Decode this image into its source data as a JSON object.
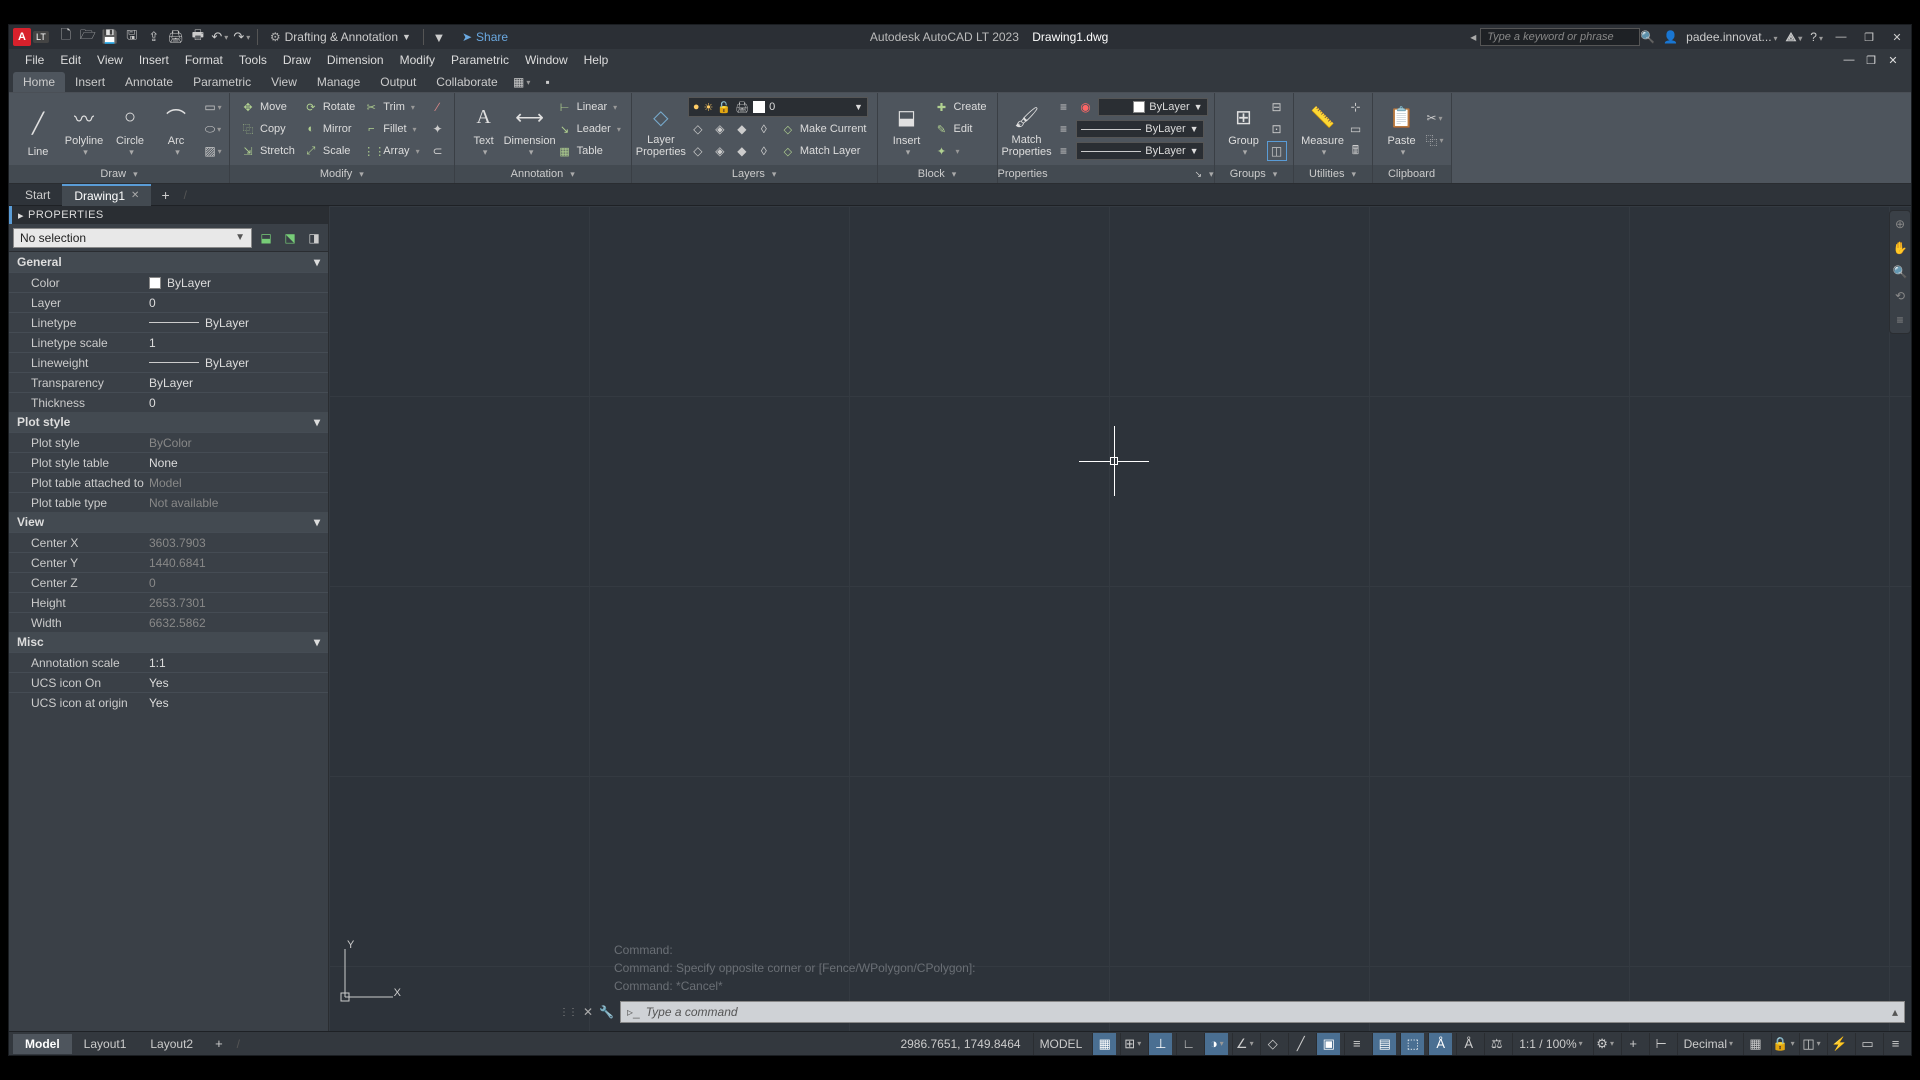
{
  "title": {
    "app": "Autodesk AutoCAD LT 2023",
    "doc": "Drawing1.dwg"
  },
  "qat_workspace": "Drafting & Annotation",
  "share": "Share",
  "search_placeholder": "Type a keyword or phrase",
  "user": "padee.innovat...",
  "menus": [
    "File",
    "Edit",
    "View",
    "Insert",
    "Format",
    "Tools",
    "Draw",
    "Dimension",
    "Modify",
    "Parametric",
    "Window",
    "Help"
  ],
  "ribbon_tabs": [
    "Home",
    "Insert",
    "Annotate",
    "Parametric",
    "View",
    "Manage",
    "Output",
    "Collaborate"
  ],
  "file_tabs": {
    "start": "Start",
    "active": "Drawing1"
  },
  "draw": {
    "line": "Line",
    "polyline": "Polyline",
    "circle": "Circle",
    "arc": "Arc",
    "title": "Draw"
  },
  "modify": {
    "move": "Move",
    "rotate": "Rotate",
    "trim": "Trim",
    "copy": "Copy",
    "mirror": "Mirror",
    "fillet": "Fillet",
    "stretch": "Stretch",
    "scale": "Scale",
    "array": "Array",
    "title": "Modify"
  },
  "annotation": {
    "text": "Text",
    "dimension": "Dimension",
    "linear": "Linear",
    "leader": "Leader",
    "table": "Table",
    "title": "Annotation"
  },
  "layers": {
    "layerprops": "Layer\nProperties",
    "layer": "0",
    "makecurrent": "Make Current",
    "matchlayer": "Match Layer",
    "title": "Layers"
  },
  "block": {
    "insert": "Insert",
    "create": "Create",
    "edit": "Edit",
    "title": "Block"
  },
  "properties": {
    "match": "Match\nProperties",
    "bylayer": "ByLayer",
    "title": "Properties"
  },
  "groups": {
    "group": "Group",
    "title": "Groups"
  },
  "utilities": {
    "measure": "Measure",
    "title": "Utilities"
  },
  "clipboard": {
    "paste": "Paste",
    "title": "Clipboard"
  },
  "palette": {
    "title": "PROPERTIES",
    "selection": "No selection",
    "general_hdr": "General",
    "general": {
      "Color": "ByLayer",
      "Layer": "0",
      "Linetype": "ByLayer",
      "Linetype scale": "1",
      "Lineweight": "ByLayer",
      "Transparency": "ByLayer",
      "Thickness": "0"
    },
    "plot_hdr": "Plot style",
    "plot": {
      "Plot style": "ByColor",
      "Plot style table": "None",
      "Plot table attached to": "Model",
      "Plot table type": "Not available"
    },
    "view_hdr": "View",
    "view": {
      "Center X": "3603.7903",
      "Center Y": "1440.6841",
      "Center Z": "0",
      "Height": "2653.7301",
      "Width": "6632.5862"
    },
    "misc_hdr": "Misc",
    "misc": {
      "Annotation scale": "1:1",
      "UCS icon On": "Yes",
      "UCS icon at origin": "Yes"
    }
  },
  "cmd_history": [
    "Command:",
    "Command: Specify opposite corner or [Fence/WPolygon/CPolygon]:",
    "Command: *Cancel*"
  ],
  "cmd_prompt": "Type a command",
  "layout_tabs": [
    "Model",
    "Layout1",
    "Layout2"
  ],
  "status": {
    "coords": "2986.7651, 1749.8464",
    "space": "MODEL",
    "scale": "1:1 / 100%",
    "units": "Decimal"
  },
  "ucs": {
    "x": "X",
    "y": "Y"
  }
}
